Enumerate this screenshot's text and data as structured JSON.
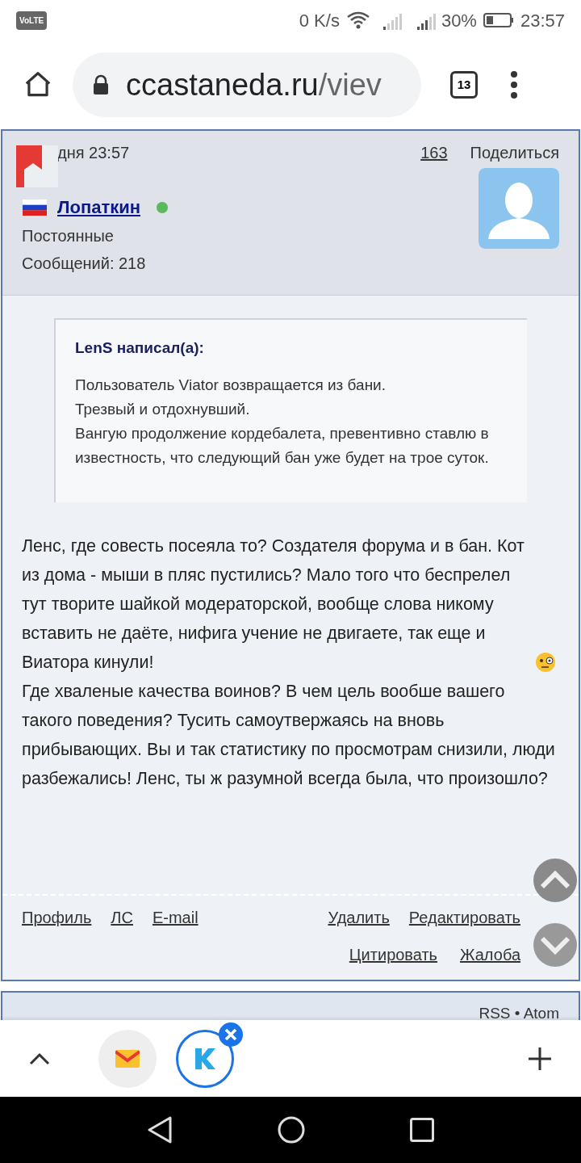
{
  "status_bar": {
    "volte": "VoLTE",
    "speed": "0 K/s",
    "battery": "30%",
    "time": "23:57"
  },
  "browser": {
    "url_host": "ccastaneda.ru",
    "url_path": "/viev",
    "tab_count": "13"
  },
  "post": {
    "date": "дня 23:57",
    "number": "163",
    "share": "Поделиться",
    "author": "Лопаткин",
    "online": true,
    "rank": "Постоянные",
    "posts": "Сообщений: 218",
    "quote": {
      "author": "LenS написал(а):",
      "lines": [
        "Пользователь Viator возвращается из бани.",
        "Трезвый и отдохнувший.",
        "Вангую продолжение кордебалета, превентивно ставлю в известность, что следующий бан уже будет на трое суток."
      ]
    },
    "body_before_emoji": "Ленс, где совесть посеяла то? Создателя форума и в бан. Кот из дома - мыши в пляс пустились? Мало того что беспрелел тут творите шайкой модераторской, вообще слова никому вставить не даёте, нифига учение не двигаете, так еще и Виатора кинули!",
    "body_after_emoji": "Где хваленые качества воинов? В чем цель вообше вашего такого поведения? Тусить самоутвержаясь на вновь прибывающих. Вы и так статистику по просмотрам снизили, люди разбежались! Ленс, ты ж разумной всегда была, что произошло?",
    "links_left": [
      "Профиль",
      "ЛС",
      "E-mail"
    ],
    "links_right": [
      "Удалить",
      "Редактировать"
    ],
    "links_right_2": [
      "Цитировать",
      "Жалоба"
    ]
  },
  "footer": {
    "feeds": "RSS • Atom"
  }
}
